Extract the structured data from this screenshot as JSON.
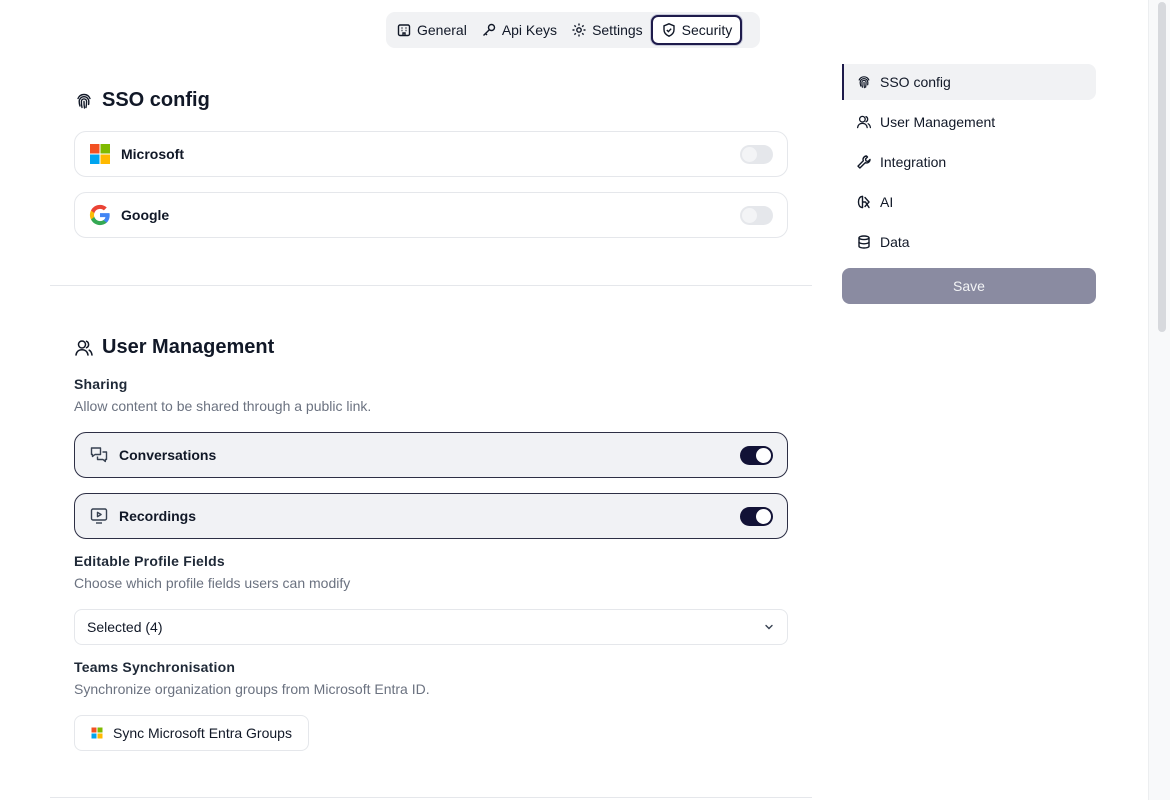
{
  "top_tabs": [
    {
      "label": "General",
      "icon": "building-icon"
    },
    {
      "label": "Api Keys",
      "icon": "key-icon"
    },
    {
      "label": "Settings",
      "icon": "gear-icon"
    },
    {
      "label": "Security",
      "icon": "shield-icon",
      "active": true
    }
  ],
  "sso": {
    "title": "SSO config",
    "providers": [
      {
        "label": "Microsoft",
        "icon": "microsoft-logo-icon",
        "enabled": false
      },
      {
        "label": "Google",
        "icon": "google-logo-icon",
        "enabled": false
      }
    ]
  },
  "user_management": {
    "title": "User Management",
    "sharing": {
      "heading": "Sharing",
      "description": "Allow content to be shared through a public link.",
      "items": [
        {
          "label": "Conversations",
          "icon": "chat-bubbles-icon",
          "enabled": true
        },
        {
          "label": "Recordings",
          "icon": "monitor-play-icon",
          "enabled": true
        }
      ]
    },
    "profile_fields": {
      "heading": "Editable Profile Fields",
      "description": "Choose which profile fields users can modify",
      "select_value": "Selected (4)"
    },
    "teams_sync": {
      "heading": "Teams Synchronisation",
      "description": "Synchronize organization groups from Microsoft Entra ID.",
      "button_label": "Sync Microsoft Entra Groups"
    }
  },
  "sidebar": {
    "items": [
      {
        "label": "SSO config",
        "icon": "fingerprint-icon",
        "active": true
      },
      {
        "label": "User Management",
        "icon": "users-icon"
      },
      {
        "label": "Integration",
        "icon": "wrench-icon"
      },
      {
        "label": "AI",
        "icon": "ai-brain-icon"
      },
      {
        "label": "Data",
        "icon": "database-icon"
      }
    ],
    "save_label": "Save"
  },
  "colors": {
    "accent": "#1e1b4b",
    "toggle_on": "#121236",
    "save_button": "#8a8ba1"
  }
}
